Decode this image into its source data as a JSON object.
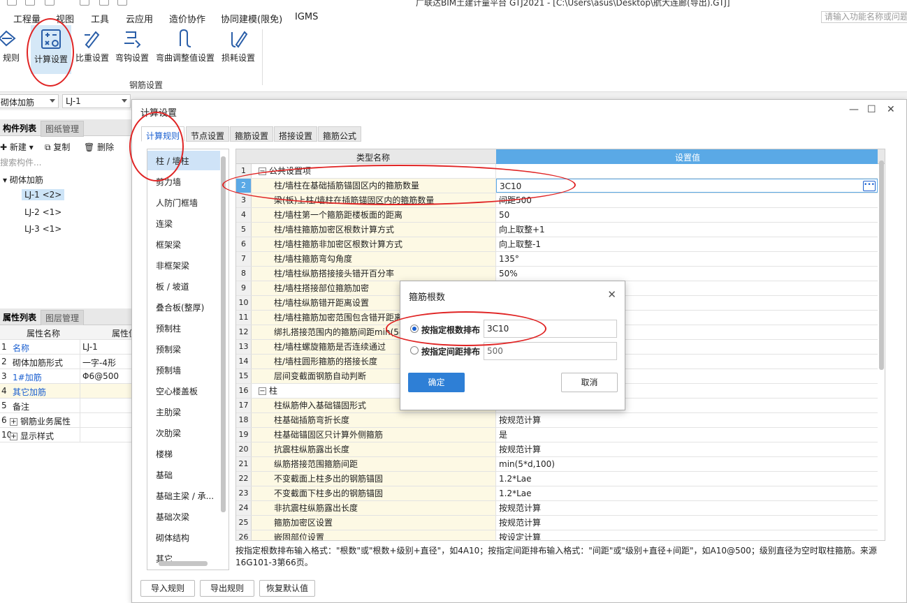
{
  "window_title": "广联达BIM土建计量平台 GTJ2021 - [C:\\Users\\asus\\Desktop\\航大连廊(导出).GTJ]",
  "menu": [
    "工程量",
    "视图",
    "工具",
    "云应用",
    "造价协作",
    "协同建模(限免)",
    "IGMS"
  ],
  "search_placeholder": "请输入功能名称或问题",
  "ribbon": {
    "left_cut_label": "规则",
    "buttons": [
      "计算设置",
      "比重设置",
      "弯钩设置",
      "弯曲调整值设置",
      "损耗设置"
    ],
    "group_label": "钢筋设置"
  },
  "subbar": {
    "combo1": "砌体加筋",
    "combo2": "LJ-1"
  },
  "component_panel": {
    "tabs": [
      "构件列表",
      "图纸管理"
    ],
    "toolbar": {
      "new": "新建",
      "copy": "复制",
      "delete": "删除"
    },
    "search_placeholder": "搜索构件...",
    "tree_root": "砌体加筋",
    "items": [
      "LJ-1 <2>",
      "LJ-2 <1>",
      "LJ-3 <1>"
    ]
  },
  "property_panel": {
    "tabs": [
      "属性列表",
      "图层管理"
    ],
    "headers": [
      "属性名称",
      "属性值"
    ],
    "rows": [
      {
        "n": "1",
        "name": "名称",
        "val": "LJ-1",
        "blue": true
      },
      {
        "n": "2",
        "name": "砌体加筋形式",
        "val": "一字-4形",
        "blue": false
      },
      {
        "n": "3",
        "name": "1#加筋",
        "val": "Φ6@500",
        "blue": true
      },
      {
        "n": "4",
        "name": "其它加筋",
        "val": "",
        "blue": true
      },
      {
        "n": "5",
        "name": "备注",
        "val": "",
        "blue": false
      },
      {
        "n": "6",
        "name": "钢筋业务属性",
        "val": "",
        "blue": false,
        "expand": true
      },
      {
        "n": "10",
        "name": "显示样式",
        "val": "",
        "blue": false,
        "expand": true
      }
    ]
  },
  "dialog": {
    "title": "计算设置",
    "tabs": [
      "计算规则",
      "节点设置",
      "箍筋设置",
      "搭接设置",
      "箍筋公式"
    ],
    "categories": [
      "柱 / 墙柱",
      "剪力墙",
      "人防门框墙",
      "连梁",
      "框架梁",
      "非框架梁",
      "板 / 坡道",
      "叠合板(整厚)",
      "预制柱",
      "预制梁",
      "预制墙",
      "空心楼盖板",
      "主肋梁",
      "次肋梁",
      "楼梯",
      "基础",
      "基础主梁 / 承...",
      "基础次梁",
      "砌体结构",
      "其它"
    ],
    "grid_headers": {
      "name": "类型名称",
      "value": "设置值"
    },
    "rows": [
      {
        "n": "1",
        "name": "公共设置项",
        "val": "",
        "group": true
      },
      {
        "n": "2",
        "name": "柱/墙柱在基础插筋锚固区内的箍筋数量",
        "val": "3C10",
        "sel": true
      },
      {
        "n": "3",
        "name": "梁(板)上柱/墙柱在插筋锚固区内的箍筋数量",
        "val": "间距500"
      },
      {
        "n": "4",
        "name": "柱/墙柱第一个箍筋距楼板面的距离",
        "val": "50"
      },
      {
        "n": "5",
        "name": "柱/墙柱箍筋加密区根数计算方式",
        "val": "向上取整+1"
      },
      {
        "n": "6",
        "name": "柱/墙柱箍筋非加密区根数计算方式",
        "val": "向上取整-1"
      },
      {
        "n": "7",
        "name": "柱/墙柱箍筋弯勾角度",
        "val": "135°"
      },
      {
        "n": "8",
        "name": "柱/墙柱纵筋搭接接头错开百分率",
        "val": "50%"
      },
      {
        "n": "9",
        "name": "柱/墙柱搭接部位箍筋加密",
        "val": ""
      },
      {
        "n": "10",
        "name": "柱/墙柱纵筋错开距离设置",
        "val": ""
      },
      {
        "n": "11",
        "name": "柱/墙柱箍筋加密范围包含错开距离",
        "val": ""
      },
      {
        "n": "12",
        "name": "绑扎搭接范围内的箍筋间距min(5d",
        "val": ""
      },
      {
        "n": "13",
        "name": "柱/墙柱螺旋箍筋是否连续通过",
        "val": ""
      },
      {
        "n": "14",
        "name": "柱/墙柱圆形箍筋的搭接长度",
        "val": ""
      },
      {
        "n": "15",
        "name": "层间变截面钢筋自动判断",
        "val": ""
      },
      {
        "n": "16",
        "name": "柱",
        "val": "",
        "group": true
      },
      {
        "n": "17",
        "name": "柱纵筋伸入基础锚固形式",
        "val": ""
      },
      {
        "n": "18",
        "name": "柱基础插筋弯折长度",
        "val": "按规范计算"
      },
      {
        "n": "19",
        "name": "柱基础锚固区只计算外侧箍筋",
        "val": "是"
      },
      {
        "n": "20",
        "name": "抗震柱纵筋露出长度",
        "val": "按规范计算"
      },
      {
        "n": "21",
        "name": "纵筋搭接范围箍筋间距",
        "val": "min(5*d,100)"
      },
      {
        "n": "22",
        "name": "不变截面上柱多出的钢筋锚固",
        "val": "1.2*Lae"
      },
      {
        "n": "23",
        "name": "不变截面下柱多出的钢筋锚固",
        "val": "1.2*Lae"
      },
      {
        "n": "24",
        "name": "非抗震柱纵筋露出长度",
        "val": "按规范计算"
      },
      {
        "n": "25",
        "name": "箍筋加密区设置",
        "val": "按规范计算"
      },
      {
        "n": "26",
        "name": "嵌固部位设置",
        "val": "按设定计算"
      }
    ],
    "hint": "按指定根数排布输入格式：\"根数\"或\"根数+级别+直径\"，如4A10；按指定间距排布输入格式：\"间距\"或\"级别+直径+间距\"，如A10@500；级别直径为空时取柱箍筋。来源16G101-3第66页。",
    "buttons": [
      "导入规则",
      "导出规则",
      "恢复默认值"
    ]
  },
  "subdialog": {
    "title": "箍筋根数",
    "option1": "按指定根数排布",
    "value1": "3C10",
    "option2": "按指定间距排布",
    "value2": "500",
    "ok": "确定",
    "cancel": "取消"
  },
  "colors": {
    "accent": "#1a5fd0",
    "header_blue": "#5aa9e6",
    "annotation_red": "#e02424",
    "name_cell_bg": "#fdf9e4"
  }
}
